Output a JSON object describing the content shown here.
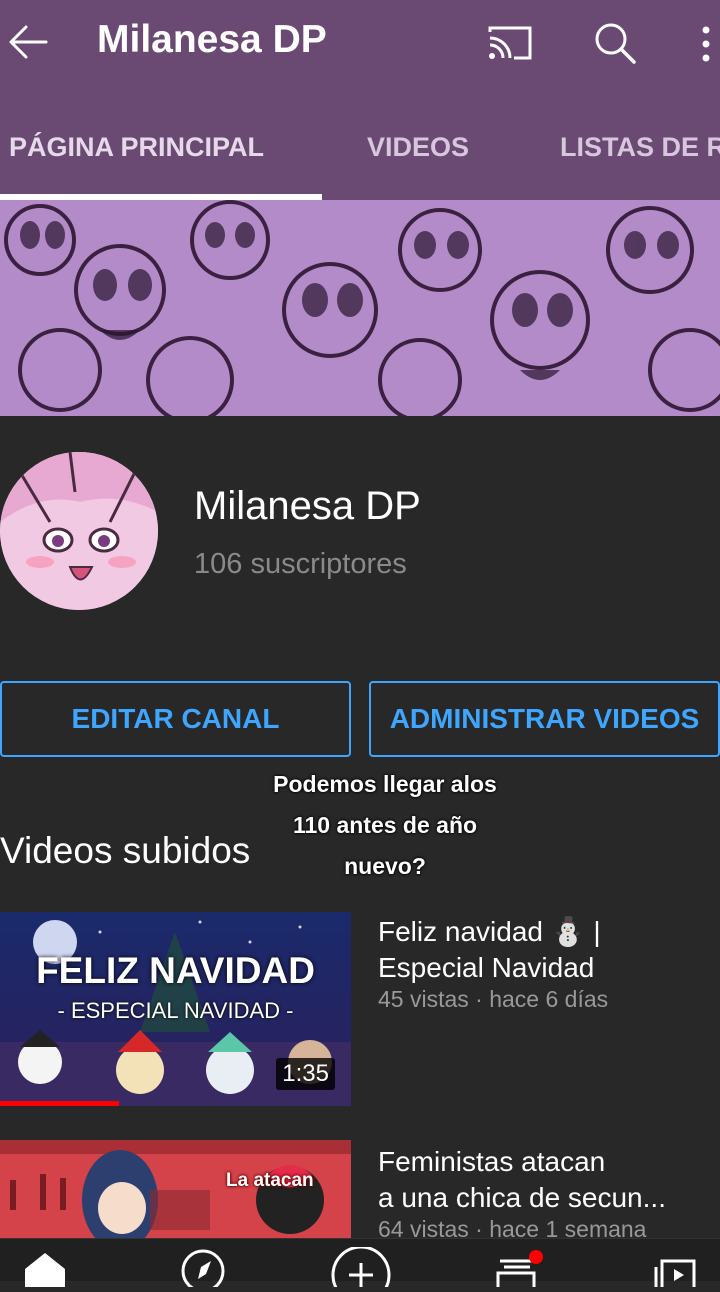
{
  "header": {
    "title": "Milanesa DP",
    "icons": [
      "back-arrow-icon",
      "cast-icon",
      "search-icon",
      "more-vert-icon"
    ]
  },
  "tabs": [
    {
      "label": "PÁGINA PRINCIPAL",
      "selected": true
    },
    {
      "label": "VIDEOS",
      "selected": false
    },
    {
      "label": "LISTAS DE R",
      "selected": false
    }
  ],
  "channel": {
    "name": "Milanesa DP",
    "subscribers": "106 suscriptores"
  },
  "actions": {
    "edit_channel": "EDITAR CANAL",
    "manage_videos": "ADMINISTRAR VIDEOS"
  },
  "overlay_text": {
    "line1": "Podemos llegar alos",
    "line2": "110 antes de año",
    "line3": "nuevo?"
  },
  "section": {
    "title": "Videos subidos"
  },
  "videos": [
    {
      "title_line1": "Feliz navidad ⛄ |",
      "title_line2": "Especial Navidad",
      "meta": "45 vistas · hace 6 días",
      "duration": "1:35",
      "progress": 0.34,
      "thumb_title": "FELIZ NAVIDAD",
      "thumb_subtitle": "- ESPECIAL NAVIDAD -"
    },
    {
      "title_line1": "Feministas atacan",
      "title_line2": "a una chica de secun...",
      "meta": "64 vistas · hace 1 semana",
      "thumb_label": "La atacan"
    }
  ],
  "bottom_nav": [
    "home-icon",
    "explore-icon",
    "add-icon",
    "subscriptions-icon",
    "library-icon"
  ],
  "colors": {
    "appbar": "#6a4a73",
    "background": "#282828",
    "accent_blue": "#3ea6ff",
    "progress_red": "#ff0000"
  }
}
